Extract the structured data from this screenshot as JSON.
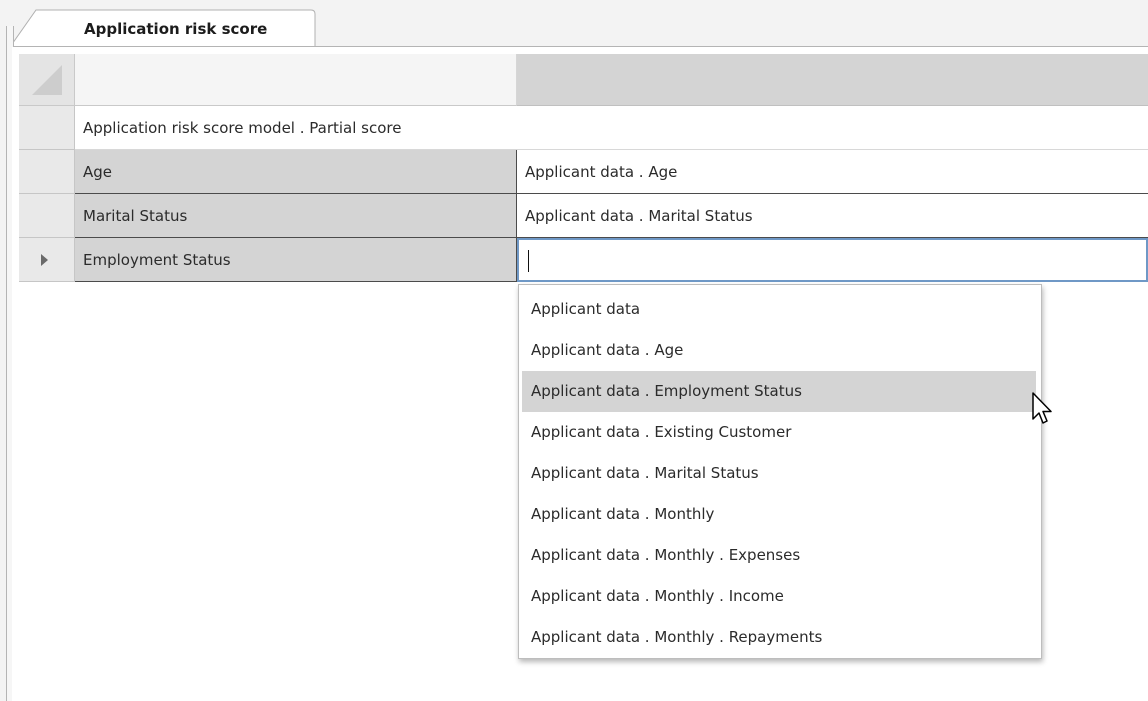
{
  "tab": {
    "label": "Application risk score"
  },
  "grid": {
    "title_row": "Application risk score model . Partial score",
    "rows": [
      {
        "source": "Age",
        "target": "Applicant data . Age"
      },
      {
        "source": "Marital Status",
        "target": "Applicant data . Marital Status"
      },
      {
        "source": "Employment Status",
        "target": ""
      }
    ]
  },
  "dropdown": {
    "options": [
      "Applicant data",
      "Applicant data . Age",
      "Applicant data . Employment Status",
      "Applicant data . Existing Customer",
      "Applicant data . Marital Status",
      "Applicant data . Monthly",
      "Applicant data . Monthly . Expenses",
      "Applicant data . Monthly . Income",
      "Applicant data . Monthly . Repayments"
    ],
    "highlighted": "Applicant data . Employment Status"
  },
  "icons": {
    "row_indicator": "current-row-triangle-icon",
    "corner": "select-all-corner-icon",
    "pointer": "mouse-pointer-icon"
  },
  "colors": {
    "highlight": "#d4d4d4",
    "edit_border": "#6f98c6"
  }
}
